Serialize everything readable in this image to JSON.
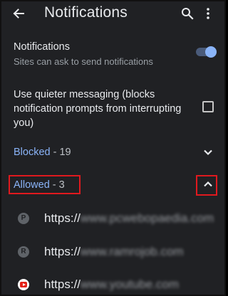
{
  "header": {
    "title": "Notifications"
  },
  "notifications_setting": {
    "title": "Notifications",
    "subtitle": "Sites can ask to send notifications",
    "enabled": true
  },
  "quieter_messaging": {
    "label": "Use quieter messaging (blocks notification prompts from interrupting you)",
    "checked": false
  },
  "blocked_section": {
    "name": "Blocked",
    "count_text": " - 19",
    "expanded": false
  },
  "allowed_section": {
    "name": "Allowed",
    "count_text": " - 3",
    "expanded": true
  },
  "allowed_sites": [
    {
      "favicon_letter": "P",
      "protocol": "https://",
      "blurred_host": "www.pcwebopaedia.com"
    },
    {
      "favicon_letter": "R",
      "protocol": "https://",
      "blurred_host": "www.ramrojob.com"
    },
    {
      "favicon_letter": "",
      "protocol": "https://",
      "blurred_host": "www.youtube.com"
    }
  ],
  "colors": {
    "background": "#202124",
    "accent": "#8ab4f8",
    "highlight_box": "#e0191e"
  },
  "icons": {
    "back": "arrow-left-icon",
    "search": "search-icon",
    "more": "more-vert-icon",
    "blocked_toggle": "chevron-down-icon",
    "allowed_toggle": "chevron-up-icon"
  }
}
